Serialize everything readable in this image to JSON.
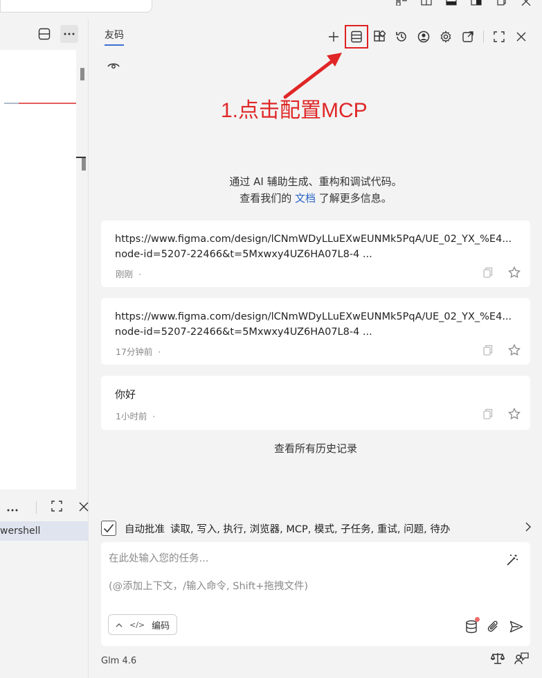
{
  "window": {
    "controls": [
      "layout-icon",
      "split-icon",
      "panel-bottom-icon",
      "panel-right-icon",
      "restore-icon",
      "close-icon"
    ]
  },
  "left_pane": {
    "toolbar": [
      "split-editor-icon",
      "more-icon"
    ],
    "terminal_toolbar": [
      "more-icon",
      "maximize-icon",
      "close-icon"
    ],
    "terminal_tab_label": "wershell"
  },
  "panel": {
    "title": "友码",
    "header_icons": [
      "add-icon",
      "mcp-config-icon",
      "extensions-icon",
      "history-icon",
      "account-icon",
      "settings-icon",
      "open-external-icon",
      "fullscreen-icon",
      "close-icon"
    ],
    "highlight_color": "#e02020"
  },
  "annotation": {
    "text": "1.点击配置MCP",
    "color": "#e02626"
  },
  "intro": {
    "line1": "通过 AI 辅助生成、重构和调试代码。",
    "line2_prefix": "查看我们的 ",
    "line2_link": "文档",
    "line2_suffix": " 了解更多信息。"
  },
  "history": [
    {
      "line1": "https://www.figma.com/design/lCNmWDyLLuEXwEUNMk5PqA/UE_02_YX_%E4...",
      "line2": "node-id=5207-22466&t=5Mxwxy4UZ6HA07L8-4 ...",
      "time": "刚刚",
      "dot": "·"
    },
    {
      "line1": "https://www.figma.com/design/lCNmWDyLLuEXwEUNMk5PqA/UE_02_YX_%E4...",
      "line2": "node-id=5207-22466&t=5Mxwxy4UZ6HA07L8-4 ...",
      "time": "17分钟前",
      "dot": "·"
    },
    {
      "line1": "你好",
      "time": "1小时前",
      "dot": "·"
    }
  ],
  "history_link": "查看所有历史记录",
  "auto_approve": {
    "checked": true,
    "label": "自动批准",
    "items": "读取, 写入, 执行, 浏览器, MCP, 模式, 子任务, 重试, 问题, 待办"
  },
  "input": {
    "placeholder_1": "在此处输入您的任务...",
    "placeholder_2": "(@添加上下文，/输入命令, Shift+拖拽文件)",
    "mode_label": "编码",
    "mode_code_glyph": "</>"
  },
  "model": "Glm 4.6",
  "accent": "#3b6fd1"
}
